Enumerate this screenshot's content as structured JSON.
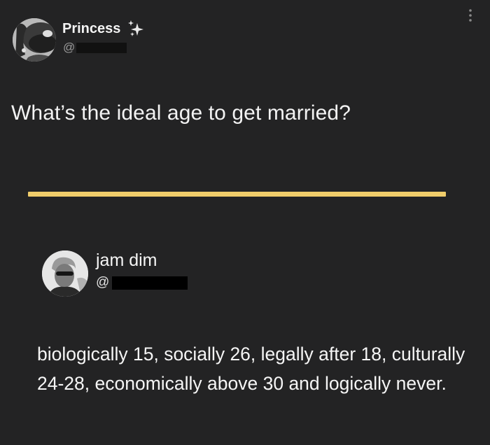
{
  "post": {
    "author_name": "Princess",
    "author_handle": "@",
    "question": "What’s the ideal age to get married?",
    "icons": [
      "sparkle-icon",
      "more-options-icon"
    ],
    "accent_color": "#f0cd6b"
  },
  "reply": {
    "author_name": "jam dim",
    "author_handle": "@",
    "text": "biologically 15, socially 26, legally after 18, culturally 24-28, economically above 30 and logically never."
  }
}
